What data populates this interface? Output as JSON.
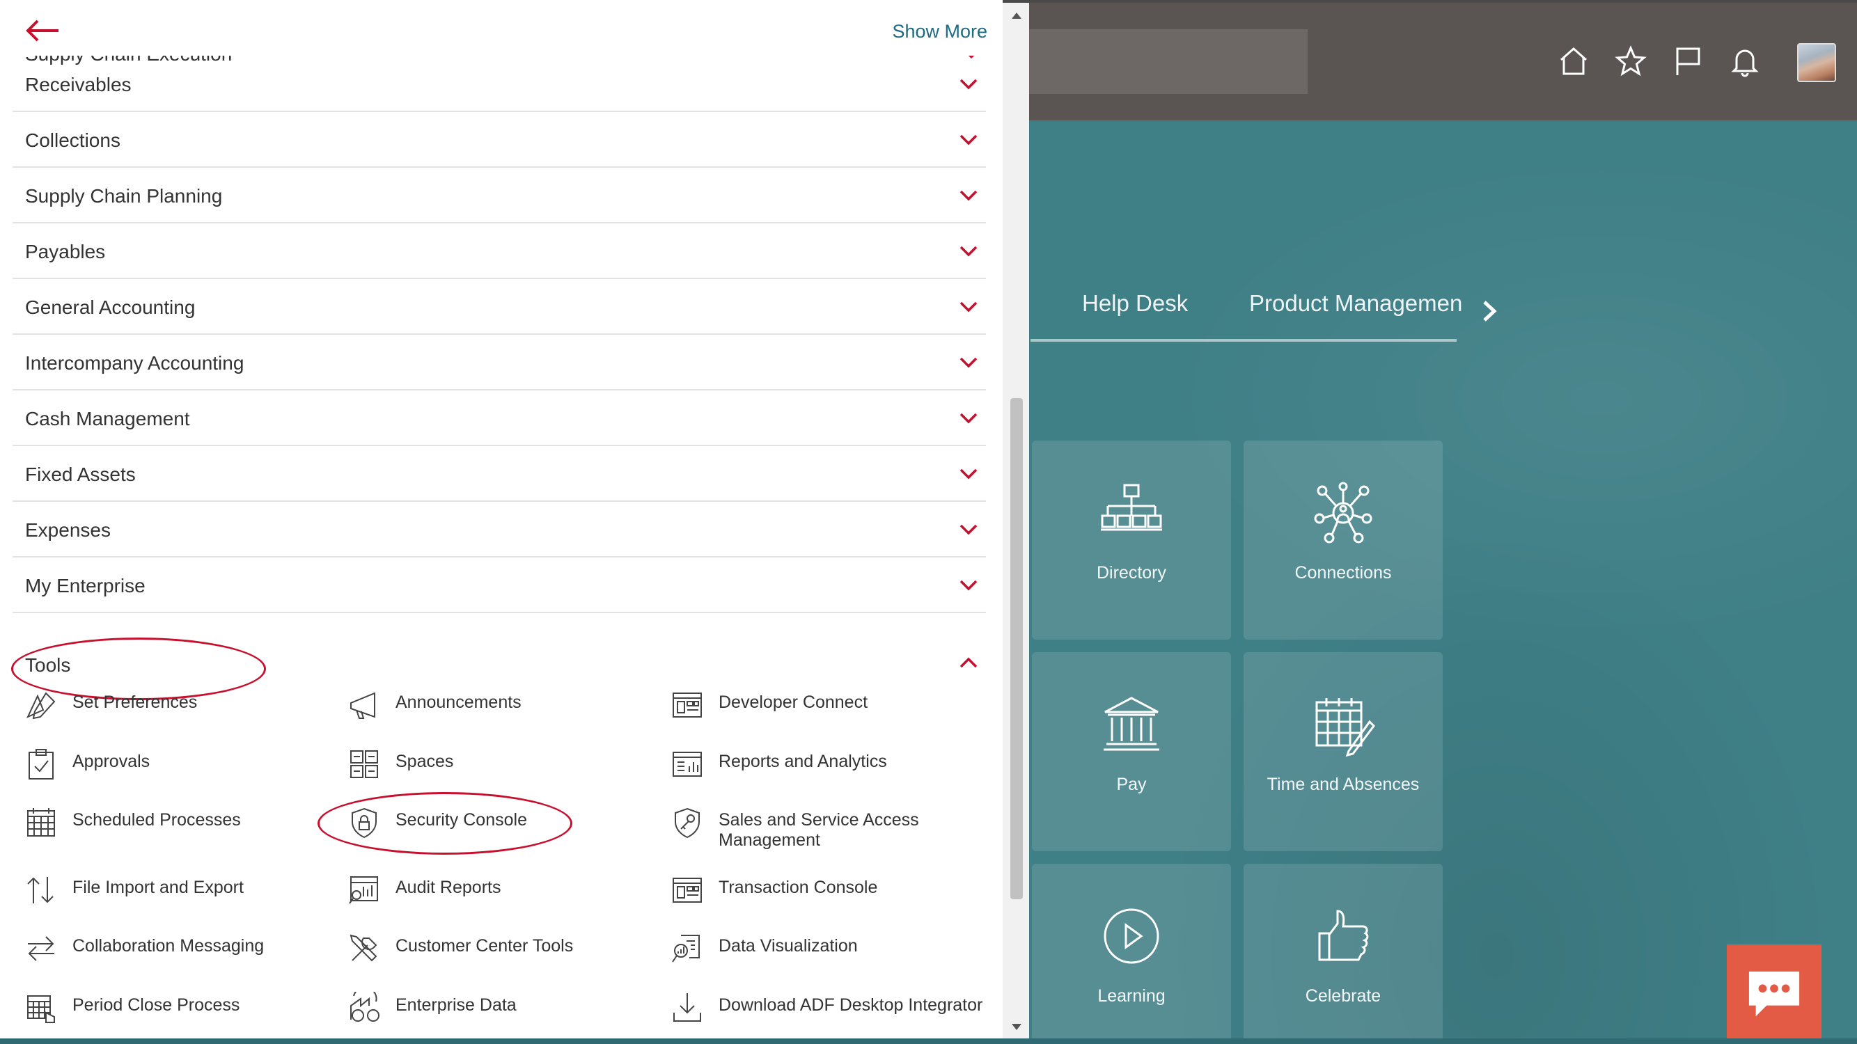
{
  "header": {
    "show_more": "Show More",
    "cutoff_item": "Supply Chain Execution"
  },
  "nav_groups": [
    {
      "label": "Receivables"
    },
    {
      "label": "Collections"
    },
    {
      "label": "Supply Chain Planning"
    },
    {
      "label": "Payables"
    },
    {
      "label": "General Accounting"
    },
    {
      "label": "Intercompany Accounting"
    },
    {
      "label": "Cash Management"
    },
    {
      "label": "Fixed Assets"
    },
    {
      "label": "Expenses"
    },
    {
      "label": "My Enterprise"
    }
  ],
  "tools": {
    "label": "Tools",
    "expanded": true,
    "items": [
      {
        "label": "Set Preferences",
        "icon": "set-preferences-icon"
      },
      {
        "label": "Announcements",
        "icon": "megaphone-icon"
      },
      {
        "label": "Developer Connect",
        "icon": "developer-connect-icon"
      },
      {
        "label": "Approvals",
        "icon": "clipboard-check-icon"
      },
      {
        "label": "Spaces",
        "icon": "spaces-grid-icon"
      },
      {
        "label": "Reports and Analytics",
        "icon": "reports-icon"
      },
      {
        "label": "Scheduled Processes",
        "icon": "calendar-grid-icon"
      },
      {
        "label": "Security Console",
        "icon": "shield-lock-icon"
      },
      {
        "label": "Sales and Service Access Management",
        "icon": "shield-key-icon"
      },
      {
        "label": "File Import and Export",
        "icon": "file-transfer-icon"
      },
      {
        "label": "Audit Reports",
        "icon": "audit-reports-icon"
      },
      {
        "label": "Transaction Console",
        "icon": "transaction-console-icon"
      },
      {
        "label": "Collaboration Messaging",
        "icon": "exchange-arrows-icon"
      },
      {
        "label": "Customer Center Tools",
        "icon": "tools-icon"
      },
      {
        "label": "Data Visualization",
        "icon": "data-visualization-icon"
      },
      {
        "label": "Period Close Process",
        "icon": "period-close-icon"
      },
      {
        "label": "Enterprise Data",
        "icon": "enterprise-data-icon"
      },
      {
        "label": "Download ADF Desktop Integrator",
        "icon": "download-icon"
      }
    ]
  },
  "background": {
    "tabs": [
      {
        "label": "Help Desk"
      },
      {
        "label": "Product Managemen"
      }
    ],
    "tiles": [
      {
        "label": "Directory",
        "icon": "org-chart-icon"
      },
      {
        "label": "Connections",
        "icon": "connections-icon"
      },
      {
        "label": "Pay",
        "icon": "bank-icon"
      },
      {
        "label": "Time and Absences",
        "icon": "calendar-pencil-icon"
      },
      {
        "label": "Learning",
        "icon": "play-circle-icon"
      },
      {
        "label": "Celebrate",
        "icon": "thumbs-up-icon"
      }
    ]
  },
  "colors": {
    "accent": "#c8102e",
    "link": "#1f6a83",
    "teal": "#3f7f86",
    "topbar": "#5a5553",
    "chat": "#e45b45"
  }
}
